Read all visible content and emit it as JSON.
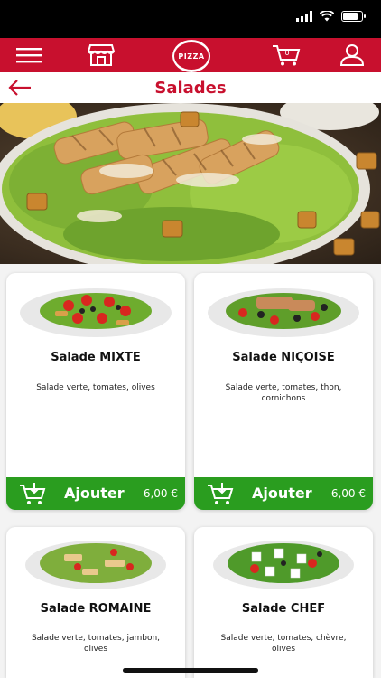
{
  "header": {
    "title": "Salades",
    "cart_count": "0",
    "logo_text": "PIZZA"
  },
  "products": [
    {
      "name": "Salade MIXTE",
      "description": "Salade verte, tomates, olives",
      "add_label": "Ajouter",
      "price": "6,00 €"
    },
    {
      "name": "Salade NIÇOISE",
      "description": "Salade verte, tomates, thon, cornichons",
      "add_label": "Ajouter",
      "price": "6,00 €"
    },
    {
      "name": "Salade ROMAINE",
      "description": "Salade verte, tomates, jambon, olives"
    },
    {
      "name": "Salade CHEF",
      "description": "Salade verte, tomates, chèvre, olives"
    }
  ],
  "colors": {
    "brand_red": "#c8102e",
    "add_green": "#2a9d1f"
  },
  "icons": [
    "menu-icon",
    "store-icon",
    "cart-icon",
    "user-icon",
    "back-arrow-icon",
    "add-to-cart-icon"
  ]
}
